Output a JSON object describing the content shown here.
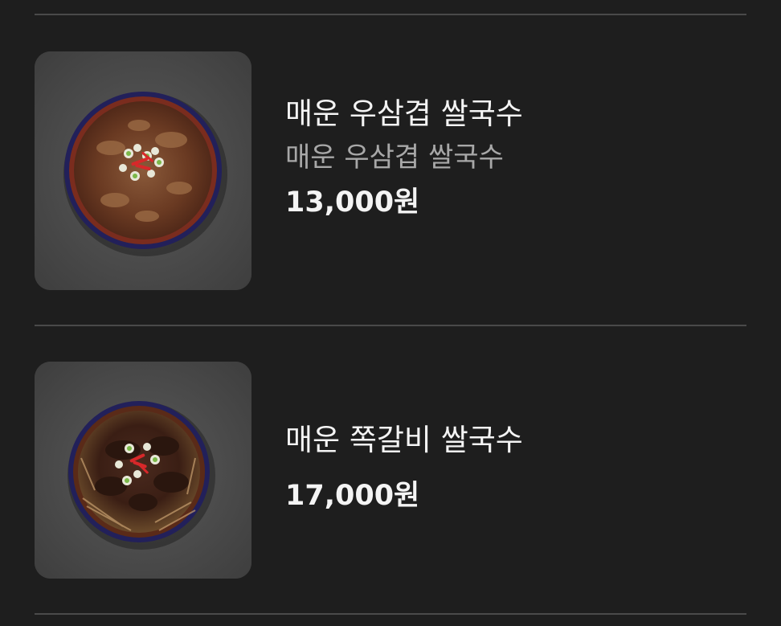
{
  "menu_items": [
    {
      "name": "매운 우삼겹 쌀국수",
      "description": "매운 우삼겹 쌀국수",
      "price": "13,000원",
      "image_icon": "noodle-bowl-image"
    },
    {
      "name": "매운 쪽갈비 쌀국수",
      "price": "17,000원",
      "image_icon": "noodle-bowl-image"
    }
  ],
  "colors": {
    "background": "#1e1e1e",
    "divider": "#4a4a4a",
    "primary_text": "#f4f4f4",
    "secondary_text": "#a8a8a8"
  }
}
